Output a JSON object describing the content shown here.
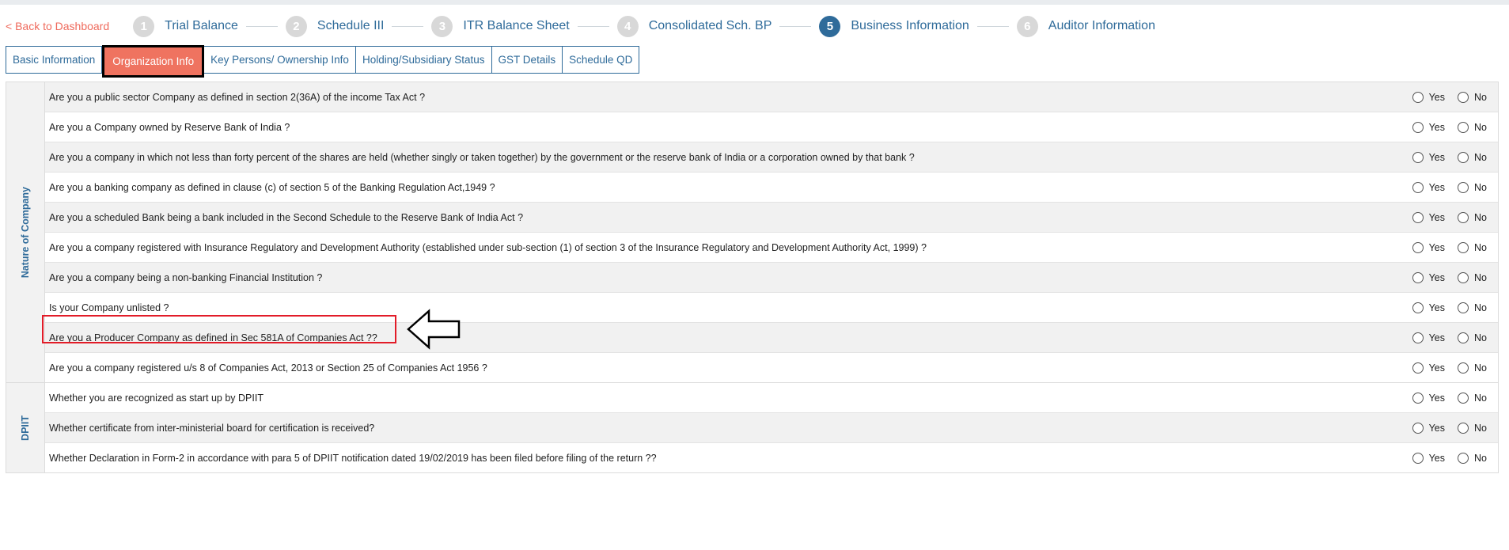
{
  "nav": {
    "back_label": "< Back to Dashboard",
    "steps": [
      {
        "num": "1",
        "label": "Trial Balance"
      },
      {
        "num": "2",
        "label": "Schedule III"
      },
      {
        "num": "3",
        "label": "ITR Balance Sheet"
      },
      {
        "num": "4",
        "label": "Consolidated Sch. BP"
      },
      {
        "num": "5",
        "label": "Business Information"
      },
      {
        "num": "6",
        "label": "Auditor Information"
      }
    ],
    "active_step": "5"
  },
  "tabs": [
    {
      "label": "Basic Information"
    },
    {
      "label": "Organization Info"
    },
    {
      "label": "Key Persons/ Ownership Info"
    },
    {
      "label": "Holding/Subsidiary Status"
    },
    {
      "label": "GST Details"
    },
    {
      "label": "Schedule QD"
    }
  ],
  "active_tab": "Organization Info",
  "options": {
    "yes": "Yes",
    "no": "No"
  },
  "groups": [
    {
      "title": "Nature of Company",
      "questions": [
        "Are you a public sector Company as defined in section 2(36A) of the income Tax Act ?",
        "Are you a Company owned by Reserve Bank of India ?",
        "Are you a company in which not less than forty percent of the shares are held (whether singly or taken together) by the government or the reserve bank of India or a corporation owned by that bank ?",
        "Are you a banking company as defined in clause (c) of section 5 of the Banking Regulation Act,1949 ?",
        "Are you a scheduled Bank being a bank included in the Second Schedule to the Reserve Bank of India Act ?",
        "Are you a company registered with Insurance Regulatory and Development Authority (established under sub-section (1) of section 3 of the Insurance Regulatory and Development Authority Act, 1999) ?",
        "Are you a company being a non-banking Financial Institution ?",
        "Is your Company unlisted ?",
        "Are you a Producer Company as defined in Sec 581A of Companies Act ??",
        "Are you a company registered u/s 8 of Companies Act, 2013 or Section 25 of Companies Act 1956 ?"
      ]
    },
    {
      "title": "DPIIT",
      "questions": [
        "Whether you are recognized as start up by DPIIT",
        "Whether certificate from inter-ministerial board for certification is received?",
        "Whether Declaration in Form-2 in accordance with para 5 of DPIIT notification dated 19/02/2019 has been filed before filing of the return ??"
      ]
    }
  ],
  "annotation": {
    "highlighted_question": "Are you a Producer Company as defined in Sec 581A of Companies Act ??"
  }
}
